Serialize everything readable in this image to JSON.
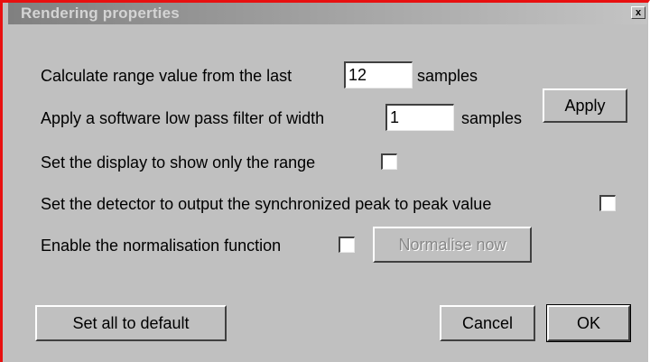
{
  "dialog": {
    "title": "Rendering properties",
    "close_label": "x"
  },
  "range": {
    "label_prefix": "Calculate range value from the last",
    "value": "12",
    "label_suffix": "samples"
  },
  "filter": {
    "label_prefix": "Apply a software low pass filter of width",
    "value": "1",
    "label_suffix": "samples"
  },
  "apply_button": "Apply",
  "options": {
    "range_only_label": "Set the display to show only the range",
    "range_only_checked": false,
    "sync_peak_label": "Set the detector to output the synchronized peak to peak value",
    "sync_peak_checked": false,
    "normalise_label": "Enable the normalisation function",
    "normalise_checked": false
  },
  "normalise_now_button": "Normalise now",
  "footer": {
    "default_button": "Set all to default",
    "cancel_button": "Cancel",
    "ok_button": "OK"
  },
  "colors": {
    "dialog_bg": "#c0c0c0",
    "border_accent": "#e81010",
    "title_gradient_start": "#808080",
    "title_text": "#d4d4d4"
  }
}
